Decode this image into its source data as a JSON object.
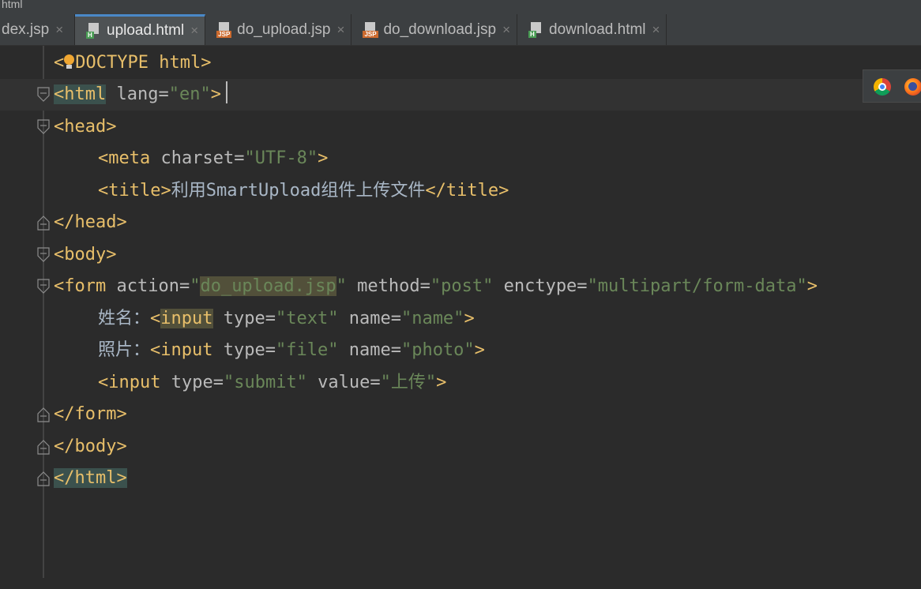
{
  "window": {
    "title_fragment": "html"
  },
  "tabs": [
    {
      "label": "dex.jsp",
      "type": "JSP",
      "active": false
    },
    {
      "label": "upload.html",
      "type": "H",
      "active": true
    },
    {
      "label": "do_upload.jsp",
      "type": "JSP",
      "active": false
    },
    {
      "label": "do_download.jsp",
      "type": "JSP",
      "active": false
    },
    {
      "label": "download.html",
      "type": "H",
      "active": false
    }
  ],
  "close_glyph": "×",
  "code": {
    "l1": {
      "open": "<",
      "doctype": "DOCTYPE html",
      "close": ">"
    },
    "l2": {
      "tag_open": "<html",
      "attr": " lang=",
      "val": "\"en\"",
      "close": ">"
    },
    "l3": {
      "tag": "<head>"
    },
    "l4": {
      "tag_open": "<meta",
      "attr": " charset=",
      "val": "\"UTF-8\"",
      "close": ">"
    },
    "l5": {
      "tag_open": "<title>",
      "text": "利用SmartUpload组件上传文件",
      "tag_close": "</title>"
    },
    "l6": {
      "tag": "</head>"
    },
    "l7": {
      "tag": "<body>"
    },
    "l8": {
      "tag_open": "<form",
      "attr1": " action=",
      "q1": "\"",
      "val1": "do_upload.jsp",
      "q2": "\"",
      "attr2": " method=",
      "val2": "\"post\"",
      "attr3": " enctype=",
      "val3": "\"multipart/form-data\"",
      "close": ">"
    },
    "l9": {
      "label": "姓名：",
      "lt": "<",
      "tag": "input",
      "attr1": " type=",
      "val1": "\"text\"",
      "attr2": " name=",
      "val2": "\"name\"",
      "close": ">"
    },
    "l10": {
      "label": "照片：",
      "tag_open": "<input",
      "attr1": " type=",
      "val1": "\"file\"",
      "attr2": " name=",
      "val2": "\"photo\"",
      "close": ">"
    },
    "l11": {
      "tag_open": "<input",
      "attr1": " type=",
      "val1": "\"submit\"",
      "attr2": " value=",
      "val2": "\"上传\"",
      "close": ">"
    },
    "l12": {
      "tag": "</form>"
    },
    "l13": {
      "tag": "</body>"
    },
    "l14": {
      "tag": "</html>"
    }
  },
  "browser_icons": [
    "chrome-icon",
    "firefox-icon"
  ]
}
